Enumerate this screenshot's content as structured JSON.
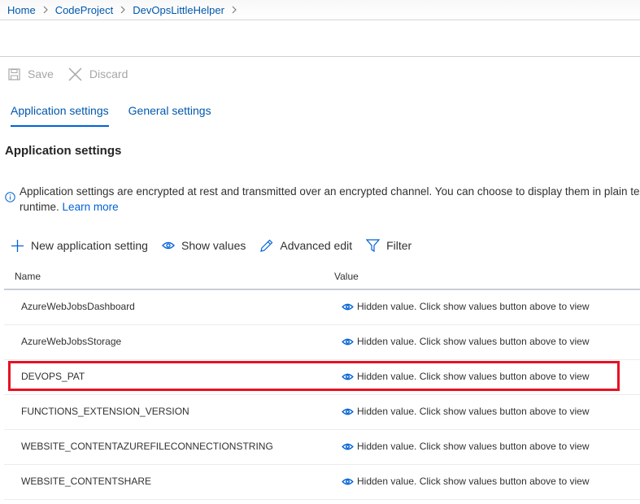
{
  "breadcrumb": {
    "items": [
      "Home",
      "CodeProject",
      "DevOpsLittleHelper"
    ]
  },
  "commandbar": {
    "save_label": "Save",
    "discard_label": "Discard"
  },
  "tabs": [
    {
      "label": "Application settings",
      "active": true
    },
    {
      "label": "General settings",
      "active": false
    }
  ],
  "section": {
    "title": "Application settings"
  },
  "info": {
    "line1": "Application settings are encrypted at rest and transmitted over an encrypted channel. You can choose to display them in plain text in your browser by using the controls below. Application Settings are exposed as environment variables for access by your application at",
    "line2_prefix": "runtime.",
    "learn_more": "Learn more"
  },
  "toolbar": {
    "new_setting": "New application setting",
    "show_values": "Show values",
    "advanced_edit": "Advanced edit",
    "filter": "Filter"
  },
  "table": {
    "columns": {
      "name": "Name",
      "value": "Value"
    },
    "rows": [
      {
        "name": "AzureWebJobsDashboard",
        "value": "Hidden value. Click show values button above to view"
      },
      {
        "name": "AzureWebJobsStorage",
        "value": "Hidden value. Click show values button above to view"
      },
      {
        "name": "DEVOPS_PAT",
        "value": "Hidden value. Click show values button above to view",
        "highlighted": true
      },
      {
        "name": "FUNCTIONS_EXTENSION_VERSION",
        "value": "Hidden value. Click show values button above to view"
      },
      {
        "name": "WEBSITE_CONTENTAZUREFILECONNECTIONSTRING",
        "value": "Hidden value. Click show values button above to view"
      },
      {
        "name": "WEBSITE_CONTENTSHARE",
        "value": "Hidden value. Click show values button above to view"
      }
    ]
  },
  "colors": {
    "link": "#0058ad",
    "accent": "#0062d6",
    "highlight_border": "#e81123",
    "disabled": "#a6a6a6"
  }
}
